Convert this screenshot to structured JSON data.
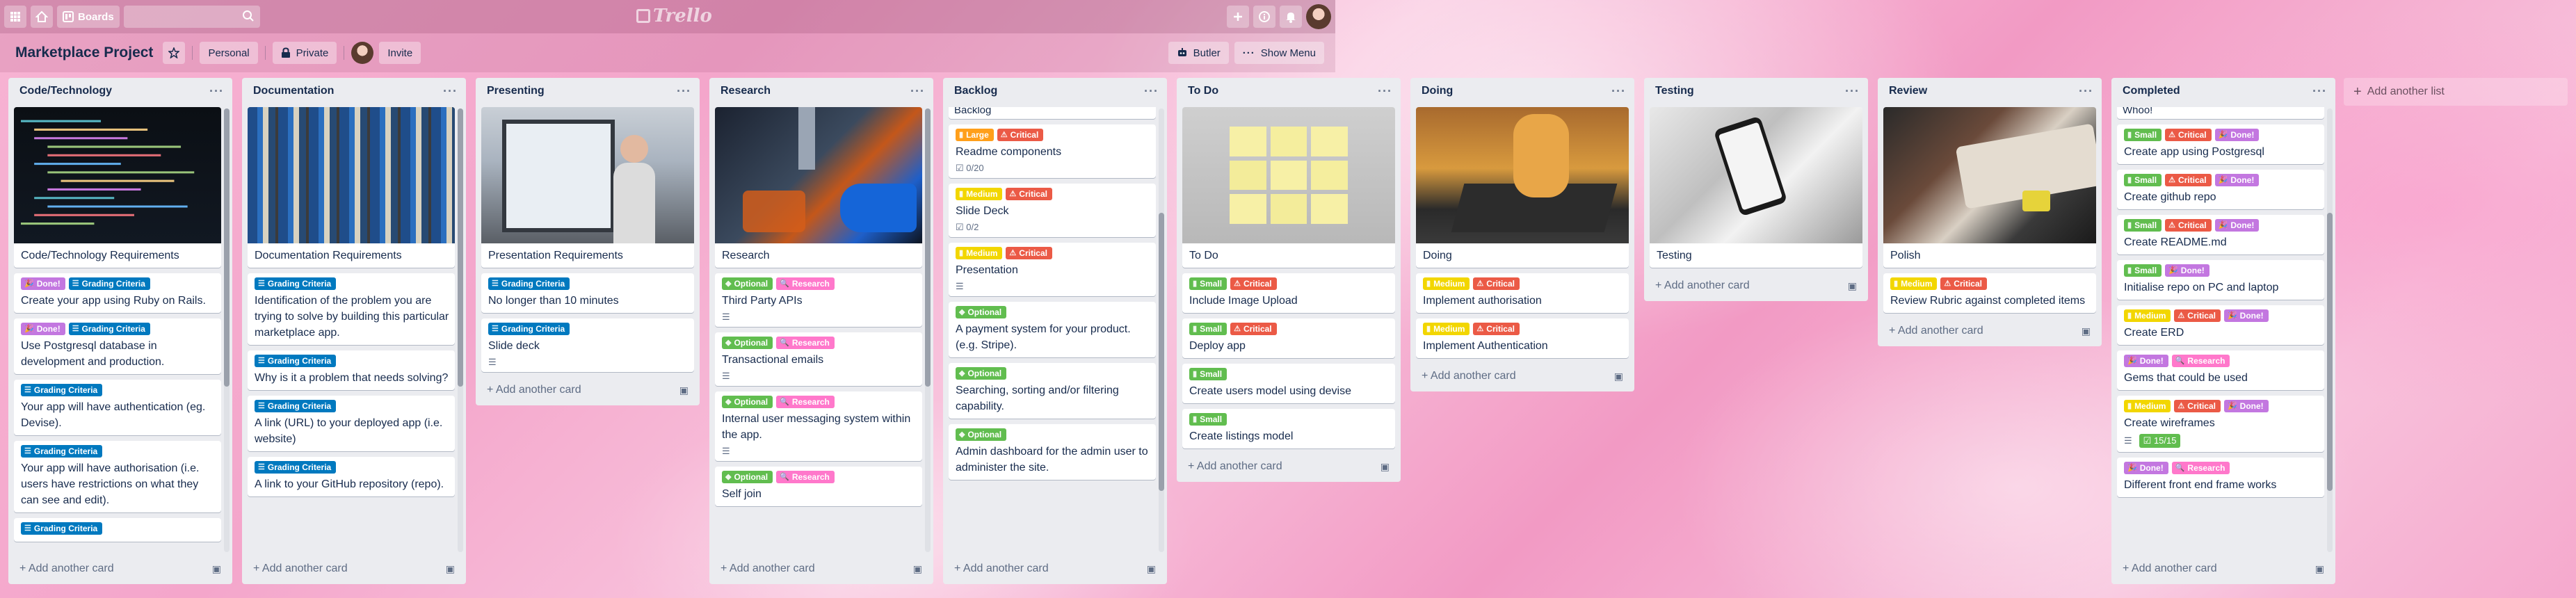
{
  "topbar": {
    "boards_label": "Boards",
    "search_placeholder": "",
    "logo_text": "Trello"
  },
  "board": {
    "title": "Marketplace Project",
    "team_label": "Personal",
    "visibility_label": "Private",
    "invite_label": "Invite",
    "butler_label": "Butler",
    "show_menu_label": "Show Menu"
  },
  "add_card_label": "Add another card",
  "add_list_label": "Add another list",
  "label_colors": {
    "green": "#61bd4f",
    "red": "#eb5a46",
    "orange": "#ff9f1a",
    "yellow": "#f2d600",
    "purple": "#c377e0",
    "pink": "#ff78cb",
    "blue": "#0079bf"
  },
  "lists": [
    {
      "title": "Code/Technology",
      "cards": [
        {
          "cover": "code",
          "title": "Code/Technology Requirements"
        },
        {
          "labels": [
            {
              "text": "Done!",
              "color": "purple"
            },
            {
              "text": "Grading Criteria",
              "color": "blue"
            }
          ],
          "title": "Create your app using Ruby on Rails."
        },
        {
          "labels": [
            {
              "text": "Done!",
              "color": "purple"
            },
            {
              "text": "Grading Criteria",
              "color": "blue"
            }
          ],
          "title": "Use Postgresql database in development and production."
        },
        {
          "labels": [
            {
              "text": "Grading Criteria",
              "color": "blue"
            }
          ],
          "title": "Your app will have authentication (eg. Devise)."
        },
        {
          "labels": [
            {
              "text": "Grading Criteria",
              "color": "blue"
            }
          ],
          "title": "Your app will have authorisation (i.e. users have restrictions on what they can see and edit)."
        },
        {
          "labels": [
            {
              "text": "Grading Criteria",
              "color": "blue"
            }
          ],
          "title": ""
        }
      ]
    },
    {
      "title": "Documentation",
      "cards": [
        {
          "cover": "binders",
          "title": "Documentation Requirements"
        },
        {
          "labels": [
            {
              "text": "Grading Criteria",
              "color": "blue"
            }
          ],
          "title": "Identification of the problem you are trying to solve by building this particular marketplace app."
        },
        {
          "labels": [
            {
              "text": "Grading Criteria",
              "color": "blue"
            }
          ],
          "title": "Why is it a problem that needs solving?"
        },
        {
          "labels": [
            {
              "text": "Grading Criteria",
              "color": "blue"
            }
          ],
          "title": "A link (URL) to your deployed app (i.e. website)"
        },
        {
          "labels": [
            {
              "text": "Grading Criteria",
              "color": "blue"
            }
          ],
          "title": "A link to your GitHub repository (repo)."
        }
      ]
    },
    {
      "title": "Presenting",
      "cards": [
        {
          "cover": "presentation",
          "title": "Presentation Requirements"
        },
        {
          "labels": [
            {
              "text": "Grading Criteria",
              "color": "blue"
            }
          ],
          "title": "No longer than 10 minutes"
        },
        {
          "labels": [
            {
              "text": "Grading Criteria",
              "color": "blue"
            }
          ],
          "title": "Slide deck",
          "desc": true
        }
      ]
    },
    {
      "title": "Research",
      "cards": [
        {
          "cover": "lab",
          "title": "Research"
        },
        {
          "labels": [
            {
              "text": "Optional",
              "color": "green"
            },
            {
              "text": "Research",
              "color": "pink"
            }
          ],
          "title": "Third Party APIs",
          "desc": true
        },
        {
          "labels": [
            {
              "text": "Optional",
              "color": "green"
            },
            {
              "text": "Research",
              "color": "pink"
            }
          ],
          "title": "Transactional emails",
          "desc": true
        },
        {
          "labels": [
            {
              "text": "Optional",
              "color": "green"
            },
            {
              "text": "Research",
              "color": "pink"
            }
          ],
          "title": "Internal user messaging system within the app.",
          "desc": true
        },
        {
          "labels": [
            {
              "text": "Optional",
              "color": "green"
            },
            {
              "text": "Research",
              "color": "pink"
            }
          ],
          "title": "Self join"
        }
      ]
    },
    {
      "title": "Backlog",
      "peek": "Backlog",
      "cards": [
        {
          "labels": [
            {
              "text": "Large",
              "color": "orange"
            },
            {
              "text": "Critical",
              "color": "red"
            }
          ],
          "title": "Readme components",
          "checklist": "0/20"
        },
        {
          "labels": [
            {
              "text": "Medium",
              "color": "yellow"
            },
            {
              "text": "Critical",
              "color": "red"
            }
          ],
          "title": "Slide Deck",
          "checklist": "0/2"
        },
        {
          "labels": [
            {
              "text": "Medium",
              "color": "yellow"
            },
            {
              "text": "Critical",
              "color": "red"
            }
          ],
          "title": "Presentation",
          "desc": true
        },
        {
          "labels": [
            {
              "text": "Optional",
              "color": "green"
            }
          ],
          "title": "A payment system for your product. (e.g. Stripe)."
        },
        {
          "labels": [
            {
              "text": "Optional",
              "color": "green"
            }
          ],
          "title": "Searching, sorting and/or filtering capability."
        },
        {
          "labels": [
            {
              "text": "Optional",
              "color": "green"
            }
          ],
          "title": "Admin dashboard for the admin user to administer the site."
        }
      ]
    },
    {
      "title": "To Do",
      "cards": [
        {
          "cover": "notes",
          "title": "To Do"
        },
        {
          "labels": [
            {
              "text": "Small",
              "color": "green"
            },
            {
              "text": "Critical",
              "color": "red"
            }
          ],
          "title": "Include Image Upload"
        },
        {
          "labels": [
            {
              "text": "Small",
              "color": "green"
            },
            {
              "text": "Critical",
              "color": "red"
            }
          ],
          "title": "Deploy app"
        },
        {
          "labels": [
            {
              "text": "Small",
              "color": "green"
            }
          ],
          "title": "Create users model using devise"
        },
        {
          "labels": [
            {
              "text": "Small",
              "color": "green"
            }
          ],
          "title": "Create listings model"
        }
      ]
    },
    {
      "title": "Doing",
      "cards": [
        {
          "cover": "laptop",
          "title": "Doing"
        },
        {
          "labels": [
            {
              "text": "Medium",
              "color": "yellow"
            },
            {
              "text": "Critical",
              "color": "red"
            }
          ],
          "title": "Implement authorisation"
        },
        {
          "labels": [
            {
              "text": "Medium",
              "color": "yellow"
            },
            {
              "text": "Critical",
              "color": "red"
            }
          ],
          "title": "Implement Authentication"
        }
      ]
    },
    {
      "title": "Testing",
      "cards": [
        {
          "cover": "phone",
          "title": "Testing"
        }
      ]
    },
    {
      "title": "Review",
      "cards": [
        {
          "cover": "polish",
          "title": "Polish"
        },
        {
          "labels": [
            {
              "text": "Medium",
              "color": "yellow"
            },
            {
              "text": "Critical",
              "color": "red"
            }
          ],
          "title": "Review Rubric against completed items"
        }
      ]
    },
    {
      "title": "Completed",
      "peek": "Whoo!",
      "cards": [
        {
          "labels": [
            {
              "text": "Small",
              "color": "green"
            },
            {
              "text": "Critical",
              "color": "red"
            },
            {
              "text": "Done!",
              "color": "purple"
            }
          ],
          "title": "Create app using Postgresql"
        },
        {
          "labels": [
            {
              "text": "Small",
              "color": "green"
            },
            {
              "text": "Critical",
              "color": "red"
            },
            {
              "text": "Done!",
              "color": "purple"
            }
          ],
          "title": "Create github repo"
        },
        {
          "labels": [
            {
              "text": "Small",
              "color": "green"
            },
            {
              "text": "Critical",
              "color": "red"
            },
            {
              "text": "Done!",
              "color": "purple"
            }
          ],
          "title": "Create README.md"
        },
        {
          "labels": [
            {
              "text": "Small",
              "color": "green"
            },
            {
              "text": "Done!",
              "color": "purple"
            }
          ],
          "title": "Initialise repo on PC and laptop"
        },
        {
          "labels": [
            {
              "text": "Medium",
              "color": "yellow"
            },
            {
              "text": "Critical",
              "color": "red"
            },
            {
              "text": "Done!",
              "color": "purple"
            }
          ],
          "title": "Create ERD"
        },
        {
          "labels": [
            {
              "text": "Done!",
              "color": "purple"
            },
            {
              "text": "Research",
              "color": "pink"
            }
          ],
          "title": "Gems that could be used"
        },
        {
          "labels": [
            {
              "text": "Medium",
              "color": "yellow"
            },
            {
              "text": "Critical",
              "color": "red"
            },
            {
              "text": "Done!",
              "color": "purple"
            }
          ],
          "title": "Create wireframes",
          "desc": true,
          "checklist_done": "15/15"
        },
        {
          "labels": [
            {
              "text": "Done!",
              "color": "purple"
            },
            {
              "text": "Research",
              "color": "pink"
            }
          ],
          "title": "Different front end frame works"
        }
      ]
    }
  ]
}
